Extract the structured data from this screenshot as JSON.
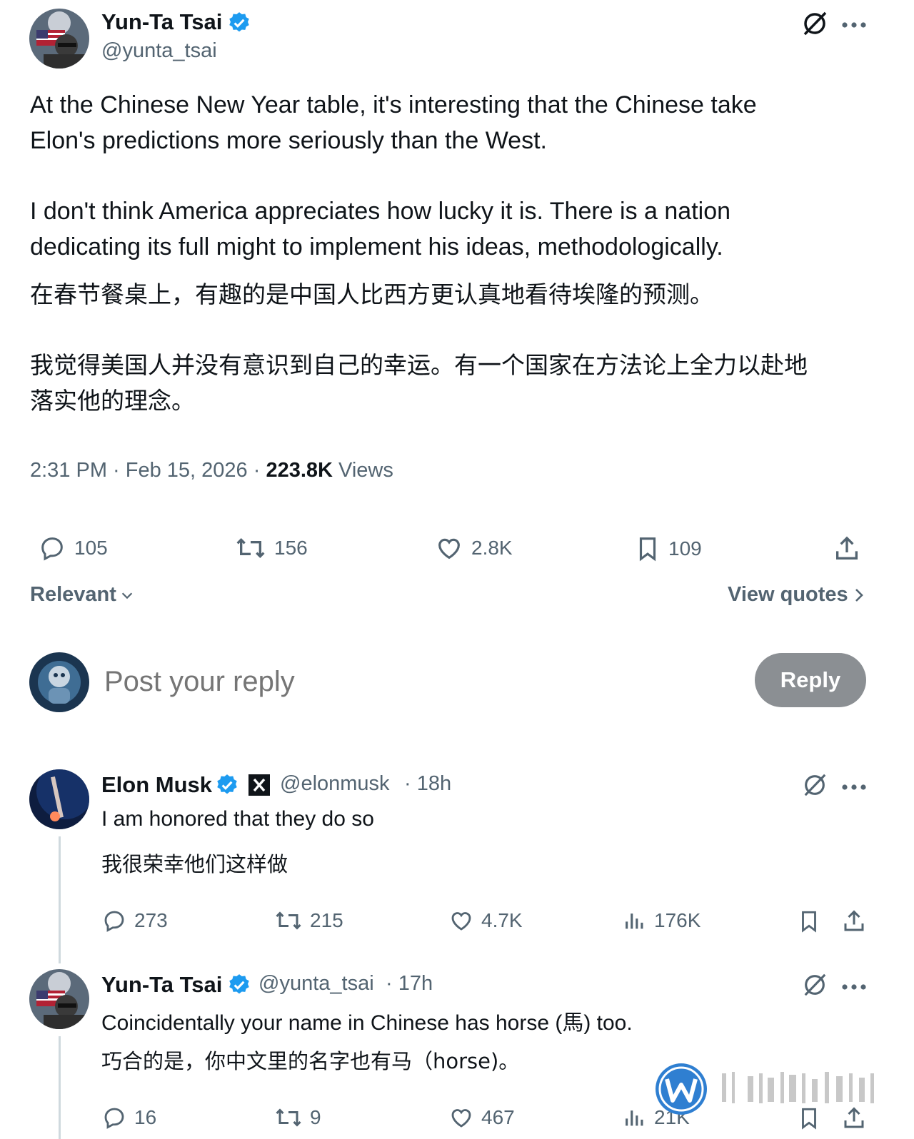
{
  "post": {
    "author_name": "Yun-Ta Tsai",
    "author_handle": "@yunta_tsai",
    "text_en_1a": "At the Chinese New Year table, it's interesting that the Chinese take",
    "text_en_1b": "Elon's predictions more seriously than the West.",
    "text_en_2a": "I don't think America appreciates how lucky it is. There is a nation",
    "text_en_2b": "dedicating its full might to implement his ideas, methodologically.",
    "text_zh_1": "在春节餐桌上，有趣的是中国人比西方更认真地看待埃隆的预测。",
    "text_zh_2a": "我觉得美国人并没有意识到自己的幸运。有一个国家在方法论上全力以赴地",
    "text_zh_2b": "落实他的理念。",
    "time": "2:31 PM · Feb 15, 2026 · ",
    "views_count": "223.8K",
    "views_label": " Views",
    "stats": {
      "replies": "105",
      "reposts": "156",
      "likes": "2.8K",
      "bookmarks": "109"
    }
  },
  "sort": {
    "label": "Relevant",
    "view_quotes": "View quotes"
  },
  "composer": {
    "placeholder": "Post your reply",
    "button": "Reply"
  },
  "replies": [
    {
      "author_name": "Elon Musk",
      "author_handle": "@elonmusk",
      "time": "· 18h",
      "text_en": "I am honored that they do so",
      "text_zh": "我很荣幸他们这样做",
      "stats": {
        "replies": "273",
        "reposts": "215",
        "likes": "4.7K",
        "views": "176K"
      }
    },
    {
      "author_name": "Yun-Ta Tsai",
      "author_handle": "@yunta_tsai",
      "time": "· 17h",
      "text_en": "Coincidentally your name in Chinese has horse (馬) too.",
      "text_zh": "巧合的是，你中文里的名字也有马（horse)。",
      "stats": {
        "replies": "16",
        "reposts": "9",
        "likes": "467",
        "views": "21K"
      }
    }
  ],
  "colors": {
    "verified": "#1d9bf0",
    "muted": "#536471",
    "reply_button": "#8b8f93"
  },
  "icons": [
    "verified-badge-icon",
    "grok-icon",
    "more-icon",
    "reply-icon",
    "repost-icon",
    "like-icon",
    "bookmark-icon",
    "share-icon",
    "views-icon",
    "x-logo-icon",
    "chevron-down-icon",
    "chevron-right-icon"
  ]
}
